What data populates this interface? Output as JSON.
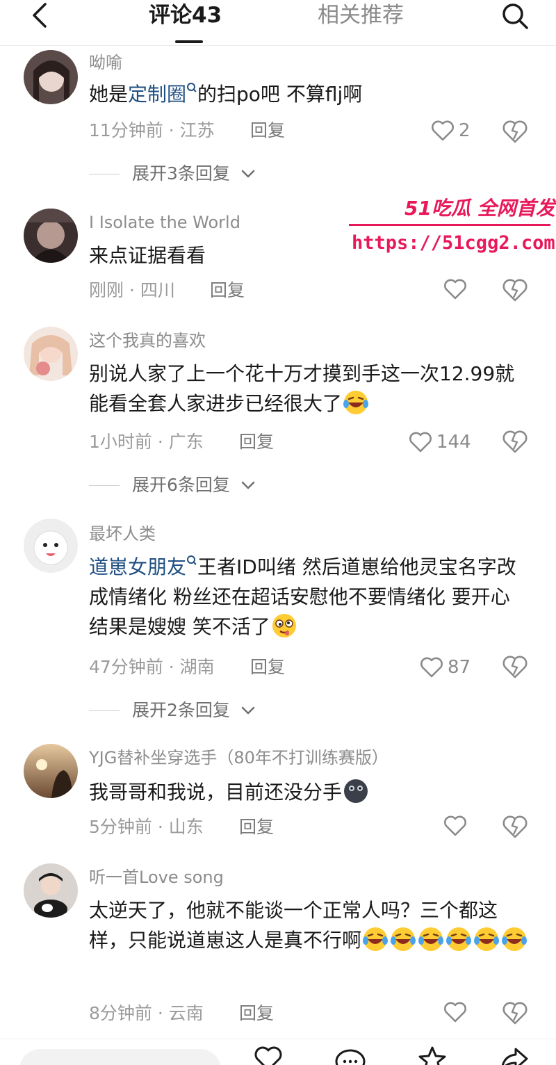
{
  "header": {
    "tab_comments": "评论43",
    "tab_related": "相关推荐"
  },
  "watermark": {
    "brand": "51吃瓜 全网首发",
    "url": "https://51cgg2.com"
  },
  "comments": [
    {
      "username": "呦喻",
      "text_parts": [
        "她是",
        "定制圈",
        "的扫po吧 不算flj啊"
      ],
      "meta": "11分钟前 · 江苏",
      "reply": "回复",
      "likes": "2",
      "expand": "展开3条回复"
    },
    {
      "username": "I Isolate the World",
      "text": "来点证据看看",
      "meta": "刚刚 · 四川",
      "reply": "回复",
      "likes": ""
    },
    {
      "username": "这个我真的喜欢",
      "text": "别说人家了上一个花十万才摸到手这一次12.99就能看全套人家进步已经很大了",
      "meta": "1小时前 · 广东",
      "reply": "回复",
      "likes": "144",
      "expand": "展开6条回复"
    },
    {
      "username": "最坏人类",
      "mention": "道崽女朋友",
      "text": "王者ID叫绪 然后道崽给他灵宝名字改成情绪化 粉丝还在超话安慰他不要情绪化 要开心 结果是嫂嫂 笑不活了",
      "meta": "47分钟前 · 湖南",
      "reply": "回复",
      "likes": "87",
      "expand": "展开2条回复"
    },
    {
      "username": "YJG替补坐穿选手（80年不打训练赛版）",
      "text": "我哥哥和我说，目前还没分手",
      "meta": "5分钟前 · 山东",
      "reply": "回复",
      "likes": ""
    },
    {
      "username": "听一首Love song",
      "text": "太逆天了，他就不能谈一个正常人吗？三个都这样，只能说道崽这人是真不行啊",
      "meta": "8分钟前 · 云南",
      "reply": "回复",
      "likes": ""
    }
  ],
  "colors": {
    "mention": "#1f4f82",
    "watermark": "#e8195a",
    "muted": "#9a9a9a"
  }
}
